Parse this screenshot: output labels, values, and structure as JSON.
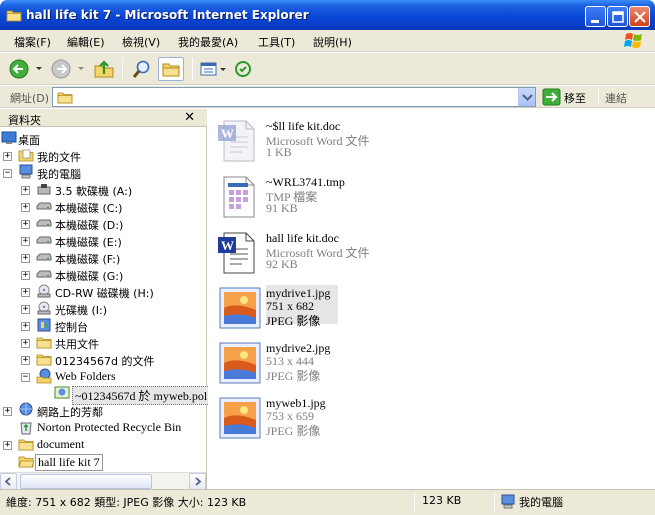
{
  "window": {
    "title": "hall life kit 7 - Microsoft Internet Explorer"
  },
  "menu": {
    "items": [
      "檔案(F)",
      "編輯(E)",
      "檢視(V)",
      "我的最愛(A)",
      "工具(T)",
      "說明(H)"
    ]
  },
  "address": {
    "label": "網址(D)",
    "value": "",
    "go_label": "移至",
    "links_label": "連結"
  },
  "folder_pane": {
    "title": "資料夾",
    "close_glyph": "✕",
    "tree": [
      {
        "label": "桌面"
      },
      {
        "label": "我的文件"
      },
      {
        "label": "我的電腦"
      },
      {
        "label": "3.5 軟碟機 (A:)"
      },
      {
        "label": "本機磁碟 (C:)"
      },
      {
        "label": "本機磁碟 (D:)"
      },
      {
        "label": "本機磁碟 (E:)"
      },
      {
        "label": "本機磁碟 (F:)"
      },
      {
        "label": "本機磁碟 (G:)"
      },
      {
        "label": "CD-RW 磁碟機 (H:)"
      },
      {
        "label": "光碟機 (I:)"
      },
      {
        "label": "控制台"
      },
      {
        "label": "共用文件"
      },
      {
        "label": "01234567d 的文件"
      },
      {
        "label": "Web Folders"
      },
      {
        "label": "~01234567d 於 myweb.pol"
      },
      {
        "label": "網路上的芳鄰"
      },
      {
        "label": "Norton Protected Recycle Bin"
      },
      {
        "label": "document"
      },
      {
        "label": "hall life kit 7"
      }
    ]
  },
  "files": [
    {
      "name": "~$ll life kit.doc",
      "line2": "Microsoft Word 文件",
      "line3": "1 KB",
      "icon": "word-doc-faded-icon"
    },
    {
      "name": "~WRL3741.tmp",
      "line2": "TMP 檔案",
      "line3": "91 KB",
      "icon": "tmp-file-icon"
    },
    {
      "name": "hall life kit.doc",
      "line2": "Microsoft Word 文件",
      "line3": "92 KB",
      "icon": "word-doc-icon"
    },
    {
      "name": "mydrive1.jpg",
      "line2": "751 x 682",
      "line3": "JPEG 影像",
      "icon": "jpeg-image-icon"
    },
    {
      "name": "mydrive2.jpg",
      "line2": "513 x 444",
      "line3": "JPEG 影像",
      "icon": "jpeg-image-icon"
    },
    {
      "name": "myweb1.jpg",
      "line2": "753 x 659",
      "line3": "JPEG 影像",
      "icon": "jpeg-image-icon"
    }
  ],
  "status": {
    "details": "維度: 751 x 682 類型: JPEG 影像 大小: 123 KB",
    "size": "123 KB",
    "zone": "我的電腦"
  }
}
